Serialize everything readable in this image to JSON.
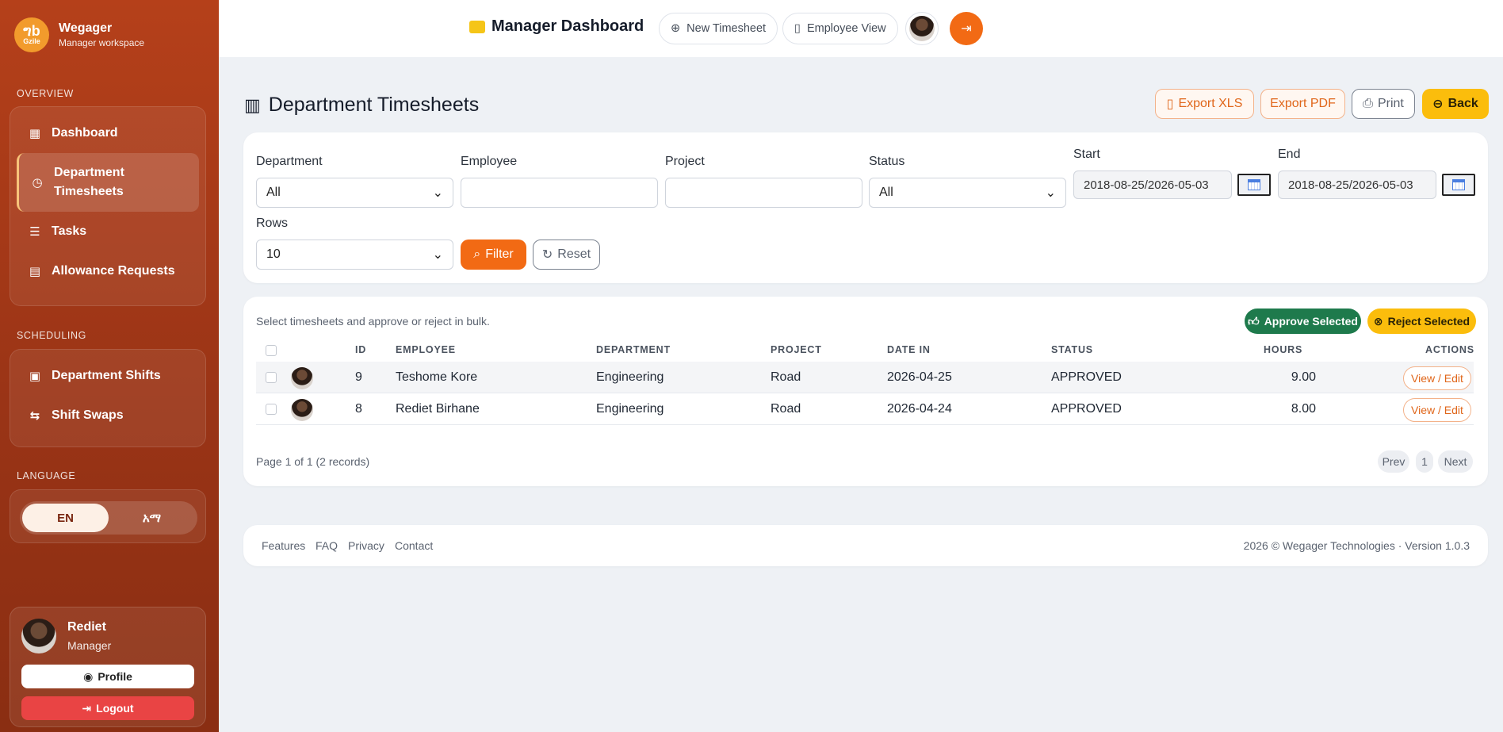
{
  "brand": {
    "logo_text": "ግb",
    "logo_sub": "Gzile",
    "name": "Wegager",
    "subtitle": "Manager workspace"
  },
  "sidebar": {
    "overview_label": "OVERVIEW",
    "overview_items": [
      {
        "label": "Dashboard",
        "icon": "dashboard-icon"
      },
      {
        "label": "Department Timesheets",
        "icon": "clock-icon",
        "active": true
      },
      {
        "label": "Tasks",
        "icon": "list-icon"
      },
      {
        "label": "Allowance Requests",
        "icon": "inbox-icon"
      }
    ],
    "scheduling_label": "SCHEDULING",
    "scheduling_items": [
      {
        "label": "Department Shifts",
        "icon": "calendar-icon"
      },
      {
        "label": "Shift Swaps",
        "icon": "swap-icon"
      }
    ],
    "language_label": "LANGUAGE",
    "languages": [
      "EN",
      "አማ"
    ],
    "user": {
      "name": "Rediet",
      "role": "Manager",
      "profile_label": "Profile",
      "logout_label": "Logout"
    }
  },
  "topbar": {
    "title": "Manager Dashboard",
    "new_timesheet": "New Timesheet",
    "employee_view": "Employee View"
  },
  "page": {
    "title": "Department Timesheets",
    "export_xls": "Export XLS",
    "export_pdf": "Export PDF",
    "print": "Print",
    "back": "Back"
  },
  "filters": {
    "department_label": "Department",
    "department_value": "All",
    "employee_label": "Employee",
    "employee_value": "",
    "project_label": "Project",
    "project_value": "",
    "status_label": "Status",
    "status_value": "All",
    "start_label": "Start",
    "start_value": "2018-08-25/2026-05-03",
    "end_label": "End",
    "end_value": "2018-08-25/2026-05-03",
    "rows_label": "Rows",
    "rows_value": "10",
    "filter_btn": "Filter",
    "reset_btn": "Reset"
  },
  "table": {
    "hint": "Select timesheets and approve or reject in bulk.",
    "approve_btn": "Approve Selected",
    "reject_btn": "Reject Selected",
    "headers": {
      "id": "ID",
      "employee": "EMPLOYEE",
      "department": "DEPARTMENT",
      "project": "PROJECT",
      "date_in": "DATE IN",
      "status": "STATUS",
      "hours": "HOURS",
      "actions": "ACTIONS"
    },
    "rows": [
      {
        "id": "9",
        "employee": "Teshome Kore",
        "department": "Engineering",
        "project": "Road",
        "date_in": "2026-04-25",
        "status": "APPROVED",
        "hours": "9.00",
        "action": "View / Edit"
      },
      {
        "id": "8",
        "employee": "Rediet Birhane",
        "department": "Engineering",
        "project": "Road",
        "date_in": "2026-04-24",
        "status": "APPROVED",
        "hours": "8.00",
        "action": "View / Edit"
      }
    ],
    "pager_info": "Page 1 of 1 (2 records)",
    "prev": "Prev",
    "page": "1",
    "next": "Next"
  },
  "footer": {
    "links": [
      "Features",
      "FAQ",
      "Privacy",
      "Contact"
    ],
    "copyright": "2026 © Wegager Technologies · Version 1.0.3"
  },
  "colors": {
    "sidebar": "#b5401a",
    "accent_orange": "#f26a14",
    "yellow": "#fbbd0c",
    "green": "#1e7a4c",
    "red": "#e94444"
  }
}
